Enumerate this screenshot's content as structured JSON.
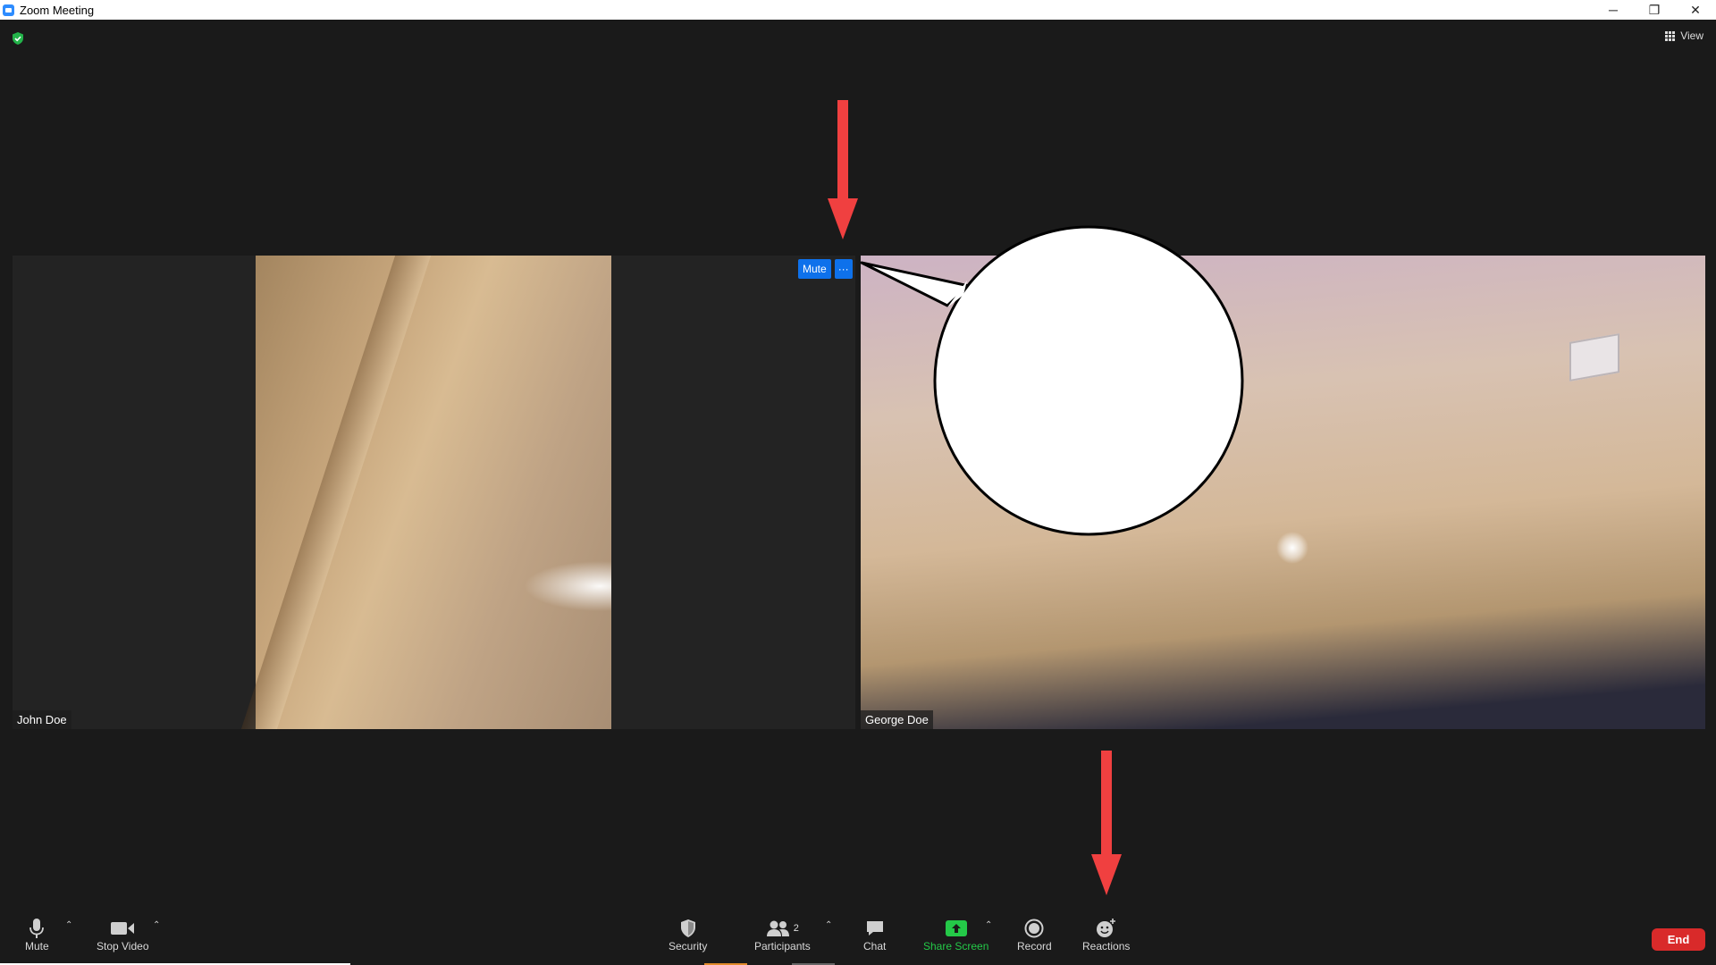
{
  "window": {
    "title": "Zoom Meeting",
    "controls": [
      "─",
      "❐",
      "✕"
    ]
  },
  "header": {
    "view_label": "View"
  },
  "participants": [
    {
      "name": "John Doe"
    },
    {
      "name": "George Doe"
    }
  ],
  "overlay": {
    "mute_label": "Mute",
    "more_label": "···"
  },
  "toolbar": {
    "mute_label": "Mute",
    "stop_video_label": "Stop Video",
    "security_label": "Security",
    "participants_label": "Participants",
    "participants_count": "2",
    "chat_label": "Chat",
    "share_screen_label": "Share Screen",
    "record_label": "Record",
    "reactions_label": "Reactions",
    "end_label": "End",
    "caret": "⌃"
  },
  "colors": {
    "background": "#1a1a1a",
    "accent_blue": "#0e71eb",
    "share_green": "#24c948",
    "end_red": "#d92a2a",
    "annotation_arrow": "#f04040"
  }
}
